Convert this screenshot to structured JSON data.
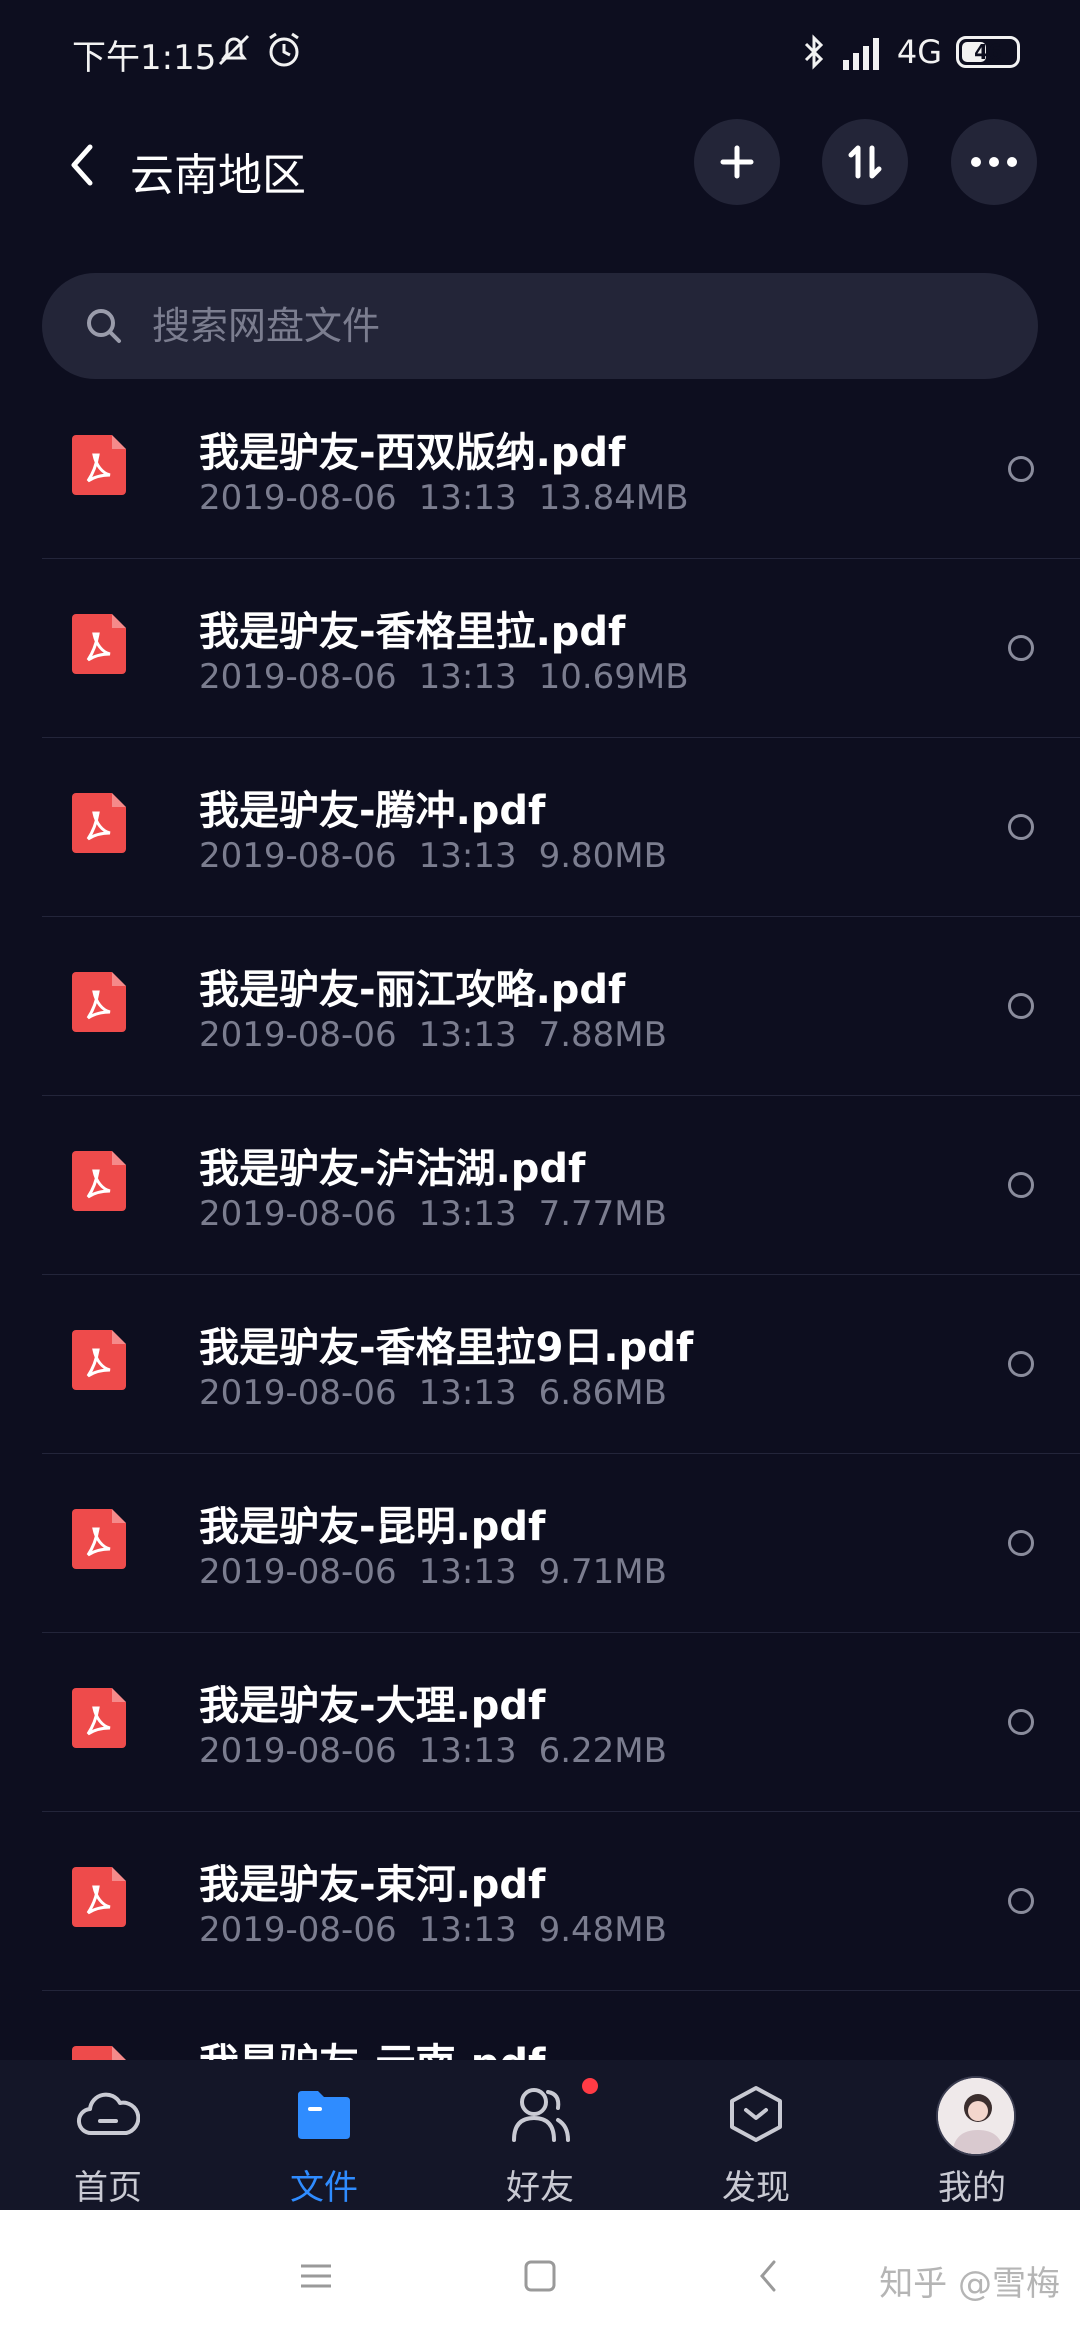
{
  "status_bar": {
    "time": "下午1:15",
    "network": "4G",
    "battery": "46",
    "battery_level": 0.46,
    "icons": [
      "mute-icon",
      "alarm-icon",
      "bluetooth-icon",
      "signal-icon",
      "battery-icon"
    ]
  },
  "header": {
    "title": "云南地区",
    "actions": [
      "add-icon",
      "sort-icon",
      "more-icon"
    ]
  },
  "search": {
    "placeholder": "搜索网盘文件"
  },
  "files": [
    {
      "name": "我是驴友-西双版纳.pdf",
      "date": "2019-08-06",
      "time": "13:13",
      "size": "13.84MB"
    },
    {
      "name": "我是驴友-香格里拉.pdf",
      "date": "2019-08-06",
      "time": "13:13",
      "size": "10.69MB"
    },
    {
      "name": "我是驴友-腾冲.pdf",
      "date": "2019-08-06",
      "time": "13:13",
      "size": "9.80MB"
    },
    {
      "name": "我是驴友-丽江攻略.pdf",
      "date": "2019-08-06",
      "time": "13:13",
      "size": "7.88MB"
    },
    {
      "name": "我是驴友-泸沽湖.pdf",
      "date": "2019-08-06",
      "time": "13:13",
      "size": "7.77MB"
    },
    {
      "name": "我是驴友-香格里拉9日.pdf",
      "date": "2019-08-06",
      "time": "13:13",
      "size": "6.86MB"
    },
    {
      "name": "我是驴友-昆明.pdf",
      "date": "2019-08-06",
      "time": "13:13",
      "size": "9.71MB"
    },
    {
      "name": "我是驴友-大理.pdf",
      "date": "2019-08-06",
      "time": "13:13",
      "size": "6.22MB"
    },
    {
      "name": "我是驴友-束河.pdf",
      "date": "2019-08-06",
      "time": "13:13",
      "size": "9.48MB"
    },
    {
      "name": "我是驴友-云南.pdf",
      "date": "",
      "time": "",
      "size": ""
    }
  ],
  "bottom_nav": [
    {
      "label": "首页",
      "icon": "cloud-icon",
      "active": false
    },
    {
      "label": "文件",
      "icon": "folder-icon",
      "active": true
    },
    {
      "label": "好友",
      "icon": "friends-icon",
      "active": false,
      "badge": true
    },
    {
      "label": "发现",
      "icon": "discover-icon",
      "active": false
    },
    {
      "label": "我的",
      "icon": "avatar",
      "active": false
    }
  ],
  "watermark": "知乎 @雪梅",
  "colors": {
    "background": "#0d0e1f",
    "accent": "#2f8cff",
    "pdf": "#ee4b4b",
    "badge": "#ff3b45"
  }
}
